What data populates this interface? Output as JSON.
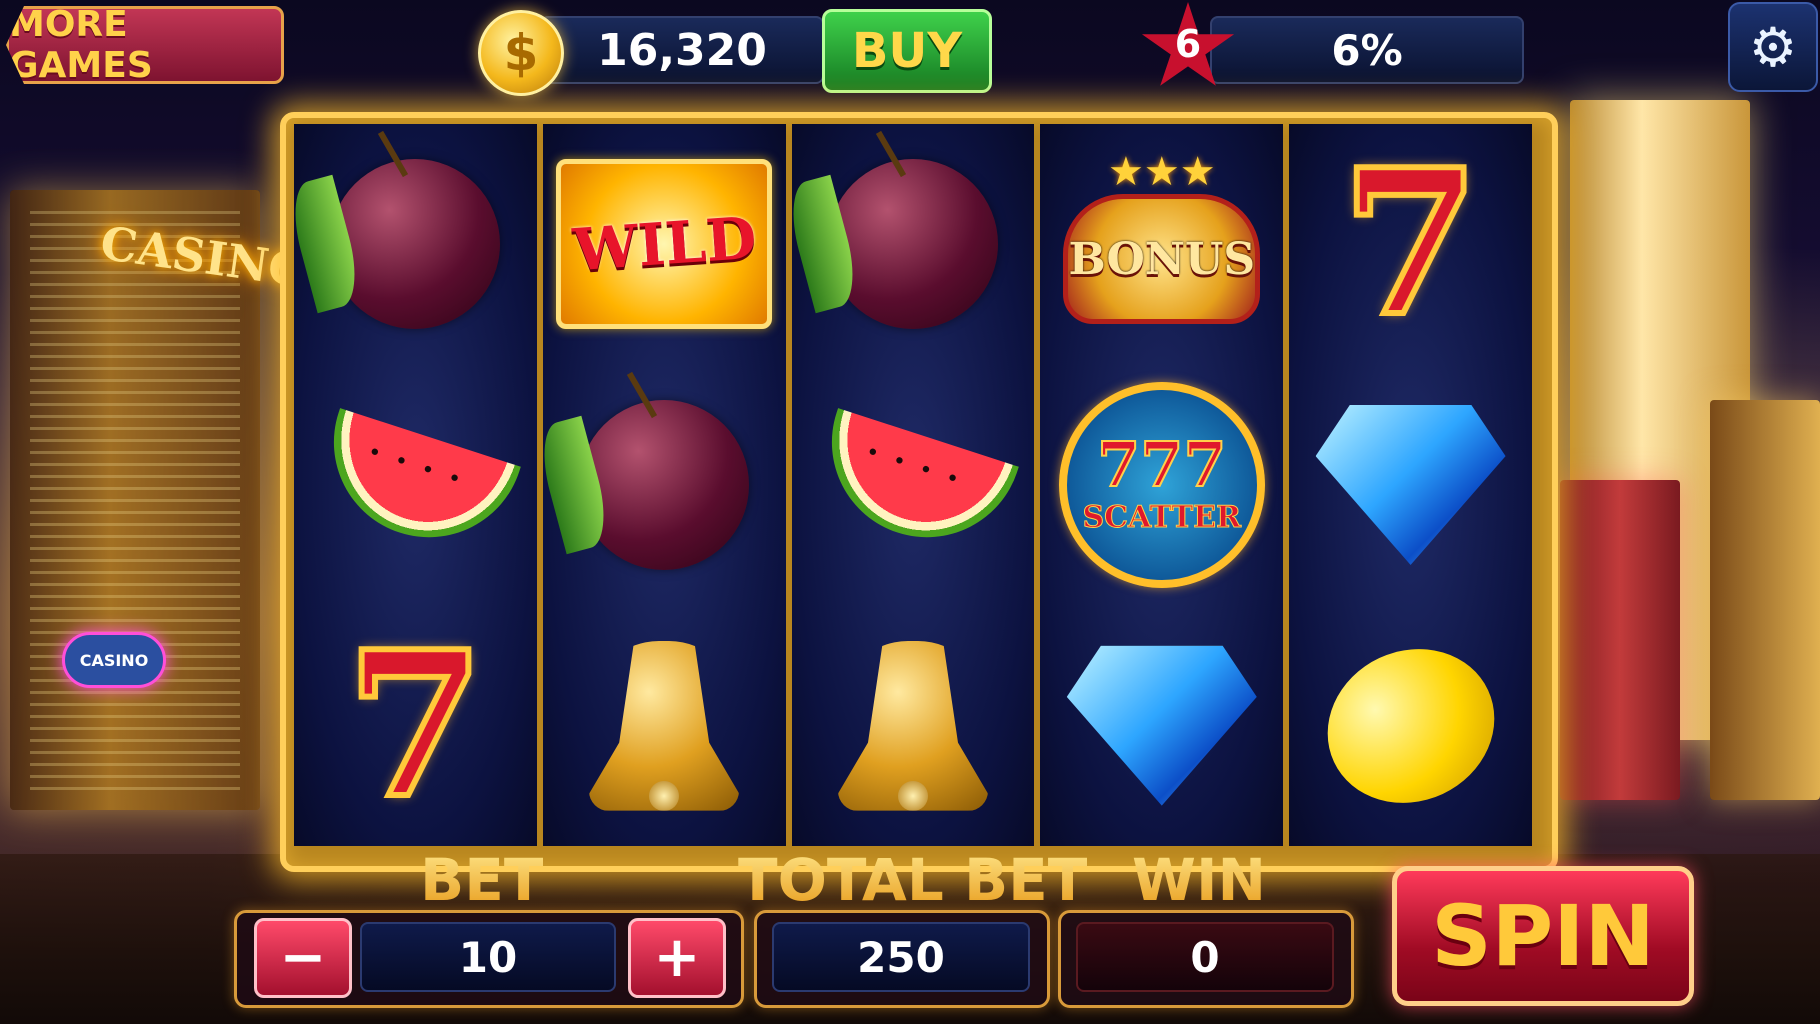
{
  "header": {
    "more_games_label": "MORE GAMES",
    "coin_icon": "$",
    "coins": "16,320",
    "buy_label": "BUY",
    "level": "6",
    "xp_percent": "6%",
    "settings_icon": "⚙"
  },
  "background": {
    "casino_sign": "CASINO",
    "small_sign": "CASINO"
  },
  "reels": [
    [
      "plum",
      "watermelon",
      "seven"
    ],
    [
      "wild",
      "plum",
      "bell"
    ],
    [
      "plum",
      "watermelon",
      "bell"
    ],
    [
      "bonus",
      "scatter",
      "diamond"
    ],
    [
      "seven",
      "diamond",
      "lemon"
    ]
  ],
  "symbols": {
    "wild_text": "WILD",
    "bonus_text": "BONUS",
    "bonus_stars": "★★★",
    "scatter_number": "777",
    "scatter_text": "SCATTER",
    "seven_text": "7"
  },
  "controls": {
    "bet_label": "BET",
    "bet_value": "10",
    "minus_label": "−",
    "plus_label": "+",
    "total_bet_label": "TOTAL BET",
    "total_bet_value": "250",
    "win_label": "WIN",
    "win_value": "0",
    "spin_label": "SPIN"
  },
  "colors": {
    "frame_gold": "#ffcf5a",
    "buy_green": "#3fd14b",
    "spin_red": "#d0102e",
    "label_gold": "#f4b82a"
  }
}
